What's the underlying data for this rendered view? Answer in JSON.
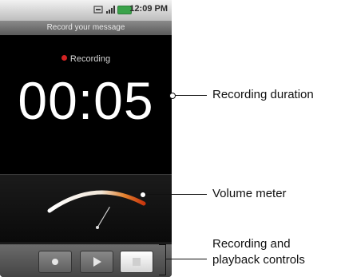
{
  "status_bar": {
    "time": "12:09 PM"
  },
  "title_bar": {
    "title": "Record your message"
  },
  "recorder": {
    "status_text": "Recording",
    "timer": "00:05",
    "volume_level": 0.72
  },
  "controls": {
    "buttons": [
      {
        "name": "record-button",
        "icon": "record-icon"
      },
      {
        "name": "play-button",
        "icon": "play-icon"
      },
      {
        "name": "stop-button",
        "icon": "stop-icon"
      }
    ]
  },
  "callouts": {
    "recording_duration": "Recording duration",
    "volume_meter": "Volume meter",
    "controls_line1": "Recording and",
    "controls_line2": "playback controls"
  },
  "colors": {
    "recording_dot": "#d22222",
    "meter_hot": "#d24a12",
    "battery": "#3aa34a"
  }
}
